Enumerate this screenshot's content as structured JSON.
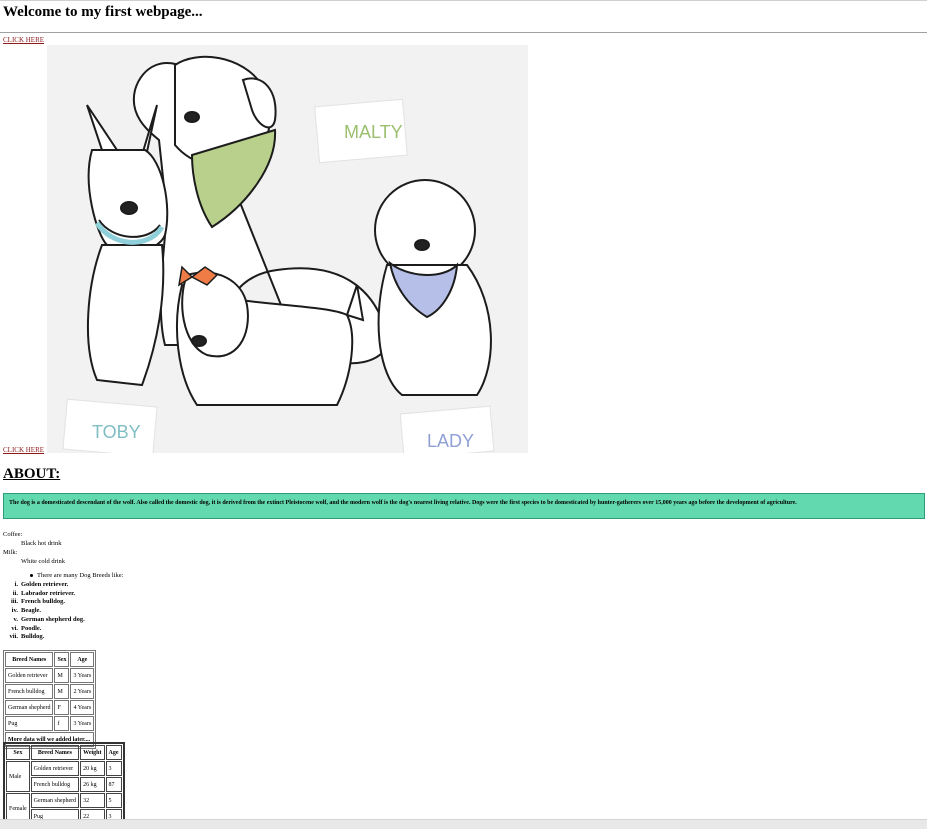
{
  "page": {
    "title": "Welcome to my first webpage...",
    "link_text": "CLICK HERE"
  },
  "image": {
    "names": [
      "MALTY",
      "TOBY",
      "LADY"
    ]
  },
  "about": {
    "heading": "ABOUT:",
    "text": "The dog is a domesticated descendant of the wolf. Also called the domestic dog, it is derived from the extinct Pleistocene wolf, and the modern wolf is the dog's nearest living relative. Dogs were the first species to be domesticated by hunter-gatherers over 15,000 years ago before the development of agriculture."
  },
  "definitions": [
    {
      "term": "Coffee:",
      "desc": "Black hot drink"
    },
    {
      "term": "Milk:",
      "desc": "White cold drink"
    }
  ],
  "bullet": "There are many Dog Breeds like:",
  "breeds": [
    {
      "num": "i.",
      "name": "Golden retriever."
    },
    {
      "num": "ii.",
      "name": "Labrador retriever."
    },
    {
      "num": "iii.",
      "name": "French bulldog."
    },
    {
      "num": "iv.",
      "name": "Beagle."
    },
    {
      "num": "v.",
      "name": "German shepherd dog."
    },
    {
      "num": "vi.",
      "name": "Poodle."
    },
    {
      "num": "vii.",
      "name": "Bulldog."
    }
  ],
  "table1": {
    "headers": [
      "Breed Names",
      "Sex",
      "Age"
    ],
    "rows": [
      [
        "Golden retriever",
        "M",
        "3 Years"
      ],
      [
        "French bulldog",
        "M",
        "2 Years"
      ],
      [
        "German shepherd",
        "F",
        "4 Years"
      ],
      [
        "Pug",
        "f",
        "3 Years"
      ]
    ],
    "footer": "More data will we added later...."
  },
  "table2": {
    "headers": [
      "Sex",
      "Breed Names",
      "Weight",
      "Age"
    ],
    "groups": [
      {
        "sex": "Male",
        "rows": [
          [
            "Golden retriever",
            "20 kg",
            "3"
          ],
          [
            "French bulldog",
            "26 kg",
            "87"
          ]
        ]
      },
      {
        "sex": "Female",
        "rows": [
          [
            "German shepherd",
            "32",
            "5"
          ],
          [
            "Pug",
            "22",
            "3"
          ]
        ]
      }
    ]
  },
  "colors": {
    "about_bg": "#63d9b0",
    "link": "#8b1a1a"
  }
}
